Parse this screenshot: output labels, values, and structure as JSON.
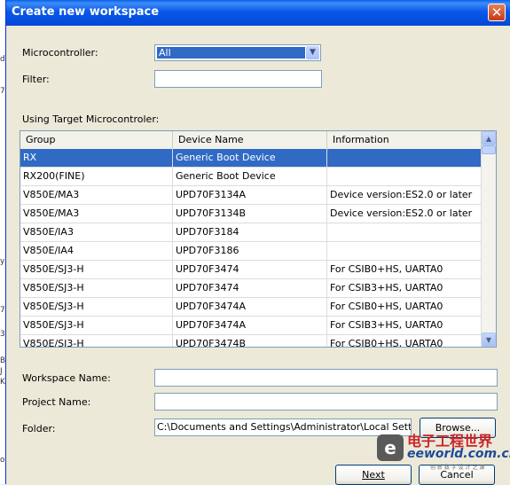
{
  "dialog": {
    "title": "Create new workspace",
    "close_glyph": "✕",
    "microcontroller_label": "Microcontroller:",
    "microcontroller_value": "All",
    "filter_label": "Filter:",
    "filter_value": "",
    "list_caption": "Using Target Microcontroler:",
    "workspace_name_label": "Workspace Name:",
    "workspace_name_value": "",
    "project_name_label": "Project Name:",
    "project_name_value": "",
    "folder_label": "Folder:",
    "folder_value": "C:\\Documents and Settings\\Administrator\\Local Settings\\Ap",
    "browse_label": "Browse...",
    "next_label": "Next",
    "cancel_label": "Cancel"
  },
  "table": {
    "headers": [
      "Group",
      "Device Name",
      "Information"
    ],
    "rows": [
      [
        "RX",
        "Generic Boot Device",
        ""
      ],
      [
        "RX200(FINE)",
        "Generic Boot Device",
        ""
      ],
      [
        "V850E/MA3",
        "UPD70F3134A",
        "Device version:ES2.0 or later"
      ],
      [
        "V850E/MA3",
        "UPD70F3134B",
        "Device version:ES2.0 or later"
      ],
      [
        "V850E/IA3",
        "UPD70F3184",
        ""
      ],
      [
        "V850E/IA4",
        "UPD70F3186",
        ""
      ],
      [
        "V850E/SJ3-H",
        "UPD70F3474",
        "For CSIB0+HS, UARTA0"
      ],
      [
        "V850E/SJ3-H",
        "UPD70F3474",
        "For CSIB3+HS, UARTA0"
      ],
      [
        "V850E/SJ3-H",
        "UPD70F3474A",
        "For CSIB0+HS, UARTA0"
      ],
      [
        "V850E/SJ3-H",
        "UPD70F3474A",
        "For CSIB3+HS, UARTA0"
      ],
      [
        "V850E/SJ3-H",
        "UPD70F3474B",
        "For CSIB0+HS, UARTA0"
      ]
    ],
    "selected_row": 0
  },
  "background_window": {
    "edge_letters": [
      "de",
      "7",
      "y",
      "7",
      "3",
      "B",
      "J",
      "K",
      "or"
    ]
  },
  "watermark": {
    "chinese": "电子工程世界",
    "english": "eeworld.com.cn",
    "sub": "创 新 数 字 设 计 之 源"
  },
  "colors": {
    "title_bar": "#0148d7",
    "selection": "#316ac5",
    "dialog_bg": "#ece9d8"
  },
  "icons": {
    "close": "close-icon",
    "dropdown": "chevron-down-icon",
    "scroll_up": "scroll-up-icon",
    "scroll_down": "scroll-down-icon"
  }
}
